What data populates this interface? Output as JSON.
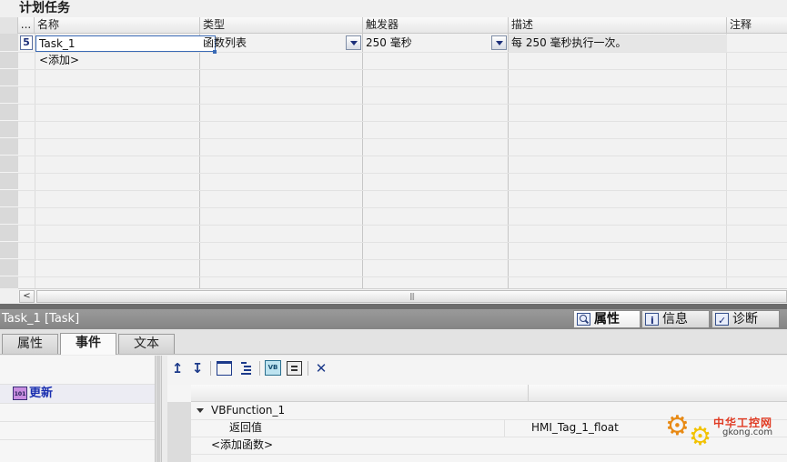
{
  "top_pane": {
    "title": "计划任务",
    "columns": {
      "menu": "...",
      "name": "名称",
      "type": "类型",
      "trigger": "触发器",
      "description": "描述",
      "comment": "注释"
    },
    "rows": [
      {
        "row_number": "5",
        "name": "Task_1",
        "type": "函数列表",
        "trigger": "250 毫秒",
        "description": "每 250 毫秒执行一次。"
      }
    ],
    "add_label": "<添加>",
    "hscroll_left": "<",
    "hscroll_grip": "|||"
  },
  "inspector": {
    "title": "Task_1 [Task]",
    "tabs": {
      "properties": "属性",
      "info": "信息",
      "diagnostics": "诊断"
    },
    "subtabs": {
      "properties": "属性",
      "events": "事件",
      "text": "文本"
    },
    "events": [
      {
        "label": "更新",
        "selected": true
      }
    ],
    "toolbar": {
      "move_up": "↥",
      "move_down": "↧",
      "delete": "✕",
      "vb_label": "VB"
    },
    "function_list": {
      "function_name": "VBFunction_1",
      "param_label": "返回值",
      "param_value": "HMI_Tag_1_float",
      "add_function": "<添加函数>"
    }
  },
  "watermark": {
    "gear_icon": "⚙",
    "site_cn": "中华工控网",
    "site_en": "gkong.com"
  },
  "colors": {
    "splitter": "#6c6c6c",
    "inspector_header": "#8e8e8e",
    "event_label": "#1a2fb0",
    "accent_blue": "#1c2f79"
  }
}
